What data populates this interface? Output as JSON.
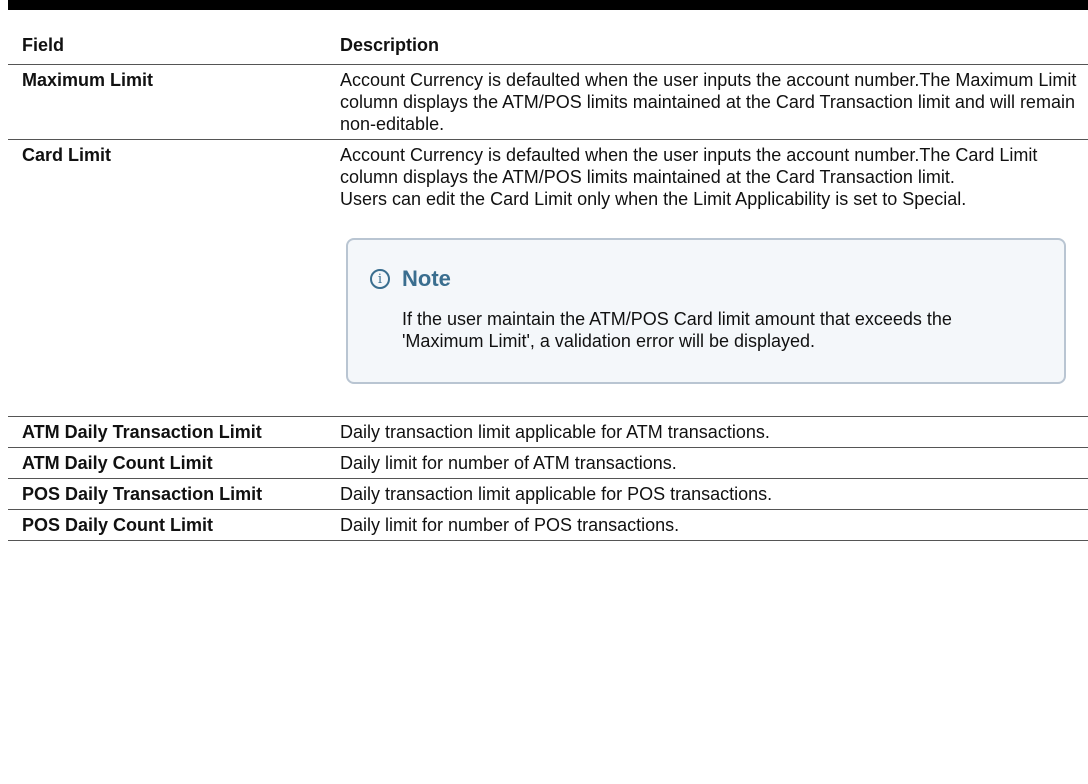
{
  "table": {
    "headers": {
      "field": "Field",
      "description": "Description"
    },
    "rows": [
      {
        "field": "Maximum Limit",
        "description": "Account Currency is defaulted when the user inputs the account number.The Maximum Limit column displays the ATM/POS limits maintained at the Card Transaction limit and will remain non-editable."
      },
      {
        "field": "Card Limit",
        "description_p1": "Account Currency is defaulted when the user inputs the account number.The Card Limit column displays the ATM/POS limits maintained at the Card Transaction limit.",
        "description_p2": "Users can edit the Card Limit only when the Limit Applicability is set to Special.",
        "note": {
          "title": "Note",
          "text": "If the user maintain the ATM/POS Card limit amount that exceeds the 'Maximum Limit', a validation error will be displayed."
        }
      },
      {
        "field": "ATM Daily Transaction Limit",
        "description": "Daily transaction limit applicable for ATM transactions."
      },
      {
        "field": "ATM Daily Count Limit",
        "description": "Daily limit for number of ATM transactions."
      },
      {
        "field": "POS Daily Transaction Limit",
        "description": "Daily transaction limit applicable for POS transactions."
      },
      {
        "field": "POS Daily Count Limit",
        "description": "Daily limit for number of POS transactions."
      }
    ]
  },
  "colors": {
    "note_accent": "#3a6e8f",
    "note_border": "#b9c5d2",
    "note_background": "#f4f7fa"
  },
  "icons": {
    "note_icon": "info-circle-icon"
  }
}
